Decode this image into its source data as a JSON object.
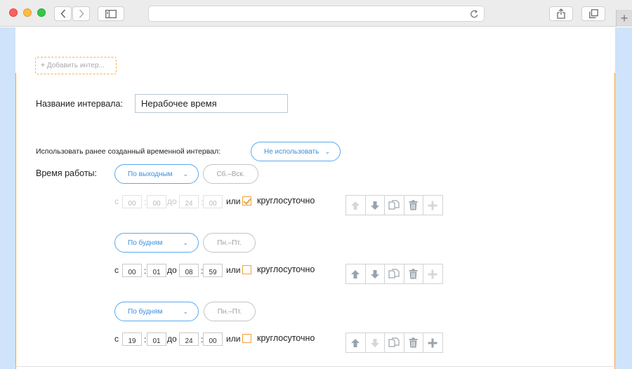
{
  "browser": {
    "url": "",
    "icons": [
      "back-icon",
      "forward-icon",
      "sidebar-icon",
      "reload-icon",
      "share-icon",
      "tabs-icon",
      "plus-icon"
    ]
  },
  "page": {
    "add_interval_label": "Добавить интер...",
    "interval_name_label": "Название интервала:",
    "interval_name_value": "Нерабочее время",
    "use_existing_label": "Использовать ранее созданный временной интервал:",
    "use_existing_value": "Не использовать",
    "work_time_label": "Время работы:",
    "accent_color": "#f2a53d",
    "link_color": "#3a8fde"
  },
  "schedules": [
    {
      "mode": "По выходным",
      "days": "Сб.–Вск.",
      "from_label": "с",
      "from_h": "00",
      "from_m": "00",
      "to_label": "до",
      "to_h": "24",
      "to_m": "00",
      "or_label": "или",
      "all_day_label": "круглосуточно",
      "all_day_checked": true
    },
    {
      "mode": "По будням",
      "days": "Пн.–Пт.",
      "from_label": "с",
      "from_h": "00",
      "from_m": "01",
      "to_label": "до",
      "to_h": "08",
      "to_m": "59",
      "or_label": "или",
      "all_day_label": "круглосуточно",
      "all_day_checked": false
    },
    {
      "mode": "По будням",
      "days": "Пн.–Пт.",
      "from_label": "с",
      "from_h": "19",
      "from_m": "01",
      "to_label": "до",
      "to_h": "24",
      "to_m": "00",
      "or_label": "или",
      "all_day_label": "круглосуточно",
      "all_day_checked": false
    }
  ]
}
